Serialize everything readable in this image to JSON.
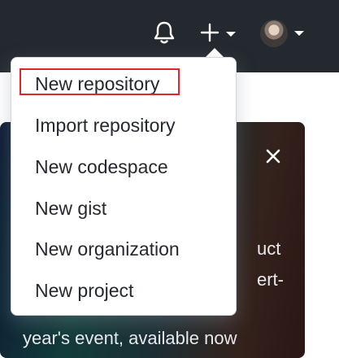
{
  "header": {
    "notifications_icon": "bell-icon",
    "create_icon": "plus-icon",
    "create_caret_icon": "caret-down-icon",
    "avatar_caret_icon": "caret-down-icon"
  },
  "create_menu": {
    "items": [
      {
        "label": "New repository",
        "highlighted": true
      },
      {
        "label": "Import repository"
      },
      {
        "label": "New codespace"
      },
      {
        "label": "New gist"
      },
      {
        "label": "New organization"
      },
      {
        "label": "New project"
      }
    ]
  },
  "promo_card": {
    "close_icon": "close-icon",
    "line_1": "uct",
    "line_2": "ert-",
    "line_3": "year's event, available now"
  },
  "colors": {
    "header_bg": "#24292f",
    "menu_text": "#24292f",
    "highlight_border": "#e0242d",
    "card_text": "#e8eaed"
  }
}
